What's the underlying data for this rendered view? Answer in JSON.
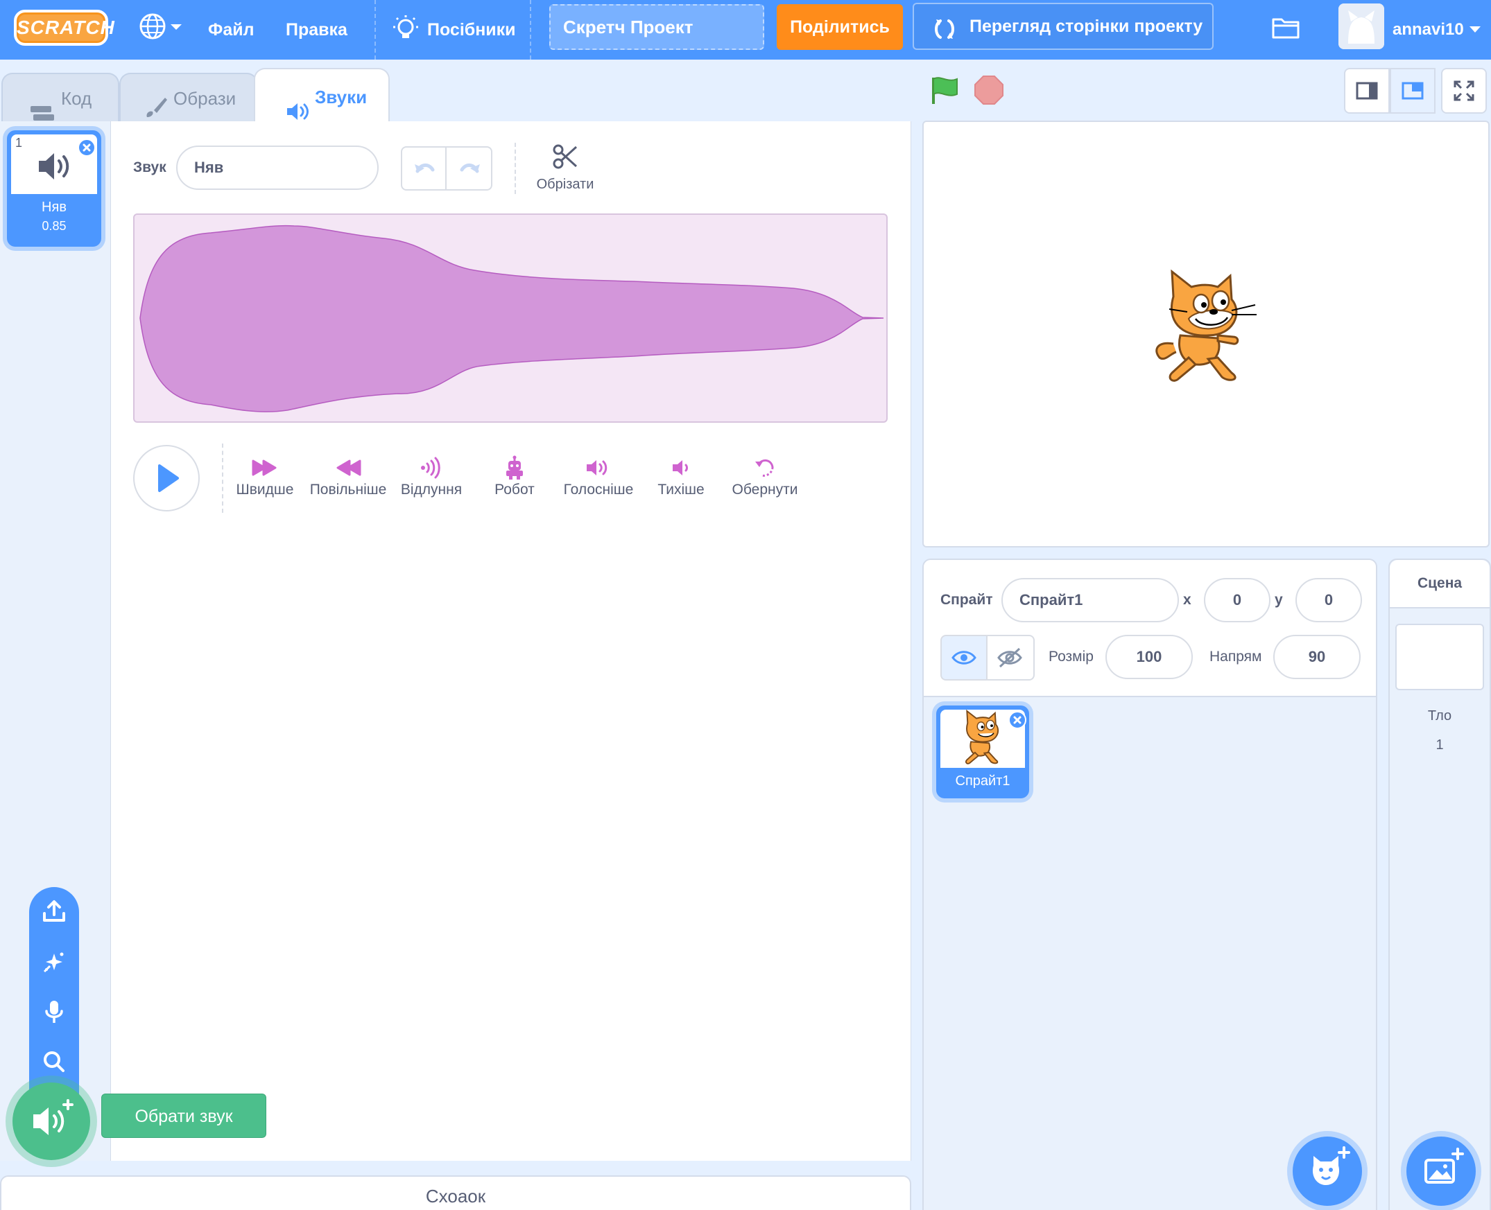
{
  "menu": {
    "logo": "SCRATCH",
    "file": "Файл",
    "edit": "Правка",
    "tutorials": "Посібники",
    "project_title": "Скретч Проект",
    "share": "Поділитись",
    "see_project_page": "Перегляд сторінки проекту",
    "username": "annavi10"
  },
  "tabs": {
    "code": "Код",
    "costumes": "Образи",
    "sounds": "Звуки"
  },
  "sound_list": [
    {
      "index": "1",
      "name": "Няв",
      "duration": "0.85"
    }
  ],
  "sound_editor": {
    "sound_label": "Звук",
    "sound_name": "Няв",
    "trim_label": "Обрізати",
    "effects": [
      {
        "label": "Швидше",
        "icon": "faster-icon"
      },
      {
        "label": "Повільніше",
        "icon": "slower-icon"
      },
      {
        "label": "Відлуння",
        "icon": "echo-icon"
      },
      {
        "label": "Робот",
        "icon": "robot-icon"
      },
      {
        "label": "Голосніше",
        "icon": "louder-icon"
      },
      {
        "label": "Тихіше",
        "icon": "softer-icon"
      },
      {
        "label": "Обернути",
        "icon": "reverse-icon"
      }
    ]
  },
  "add_sound": {
    "tooltip": "Обрати звук"
  },
  "backpack": {
    "label": "Схоаок"
  },
  "sprite_info": {
    "sprite_label": "Спрайт",
    "sprite_name": "Спрайт1",
    "x_label": "x",
    "x_value": "0",
    "y_label": "y",
    "y_value": "0",
    "size_label": "Розмір",
    "size_value": "100",
    "direction_label": "Напрям",
    "direction_value": "90"
  },
  "sprites": [
    {
      "name": "Спрайт1"
    }
  ],
  "stage_pane": {
    "title": "Сцена",
    "backdrops_label": "Тло",
    "backdrops_count": "1"
  },
  "colors": {
    "menu_blue": "#4c97ff",
    "share_orange": "#ff8c1a",
    "sound_purple": "#cf63cf",
    "add_green": "#4cbf8c"
  }
}
